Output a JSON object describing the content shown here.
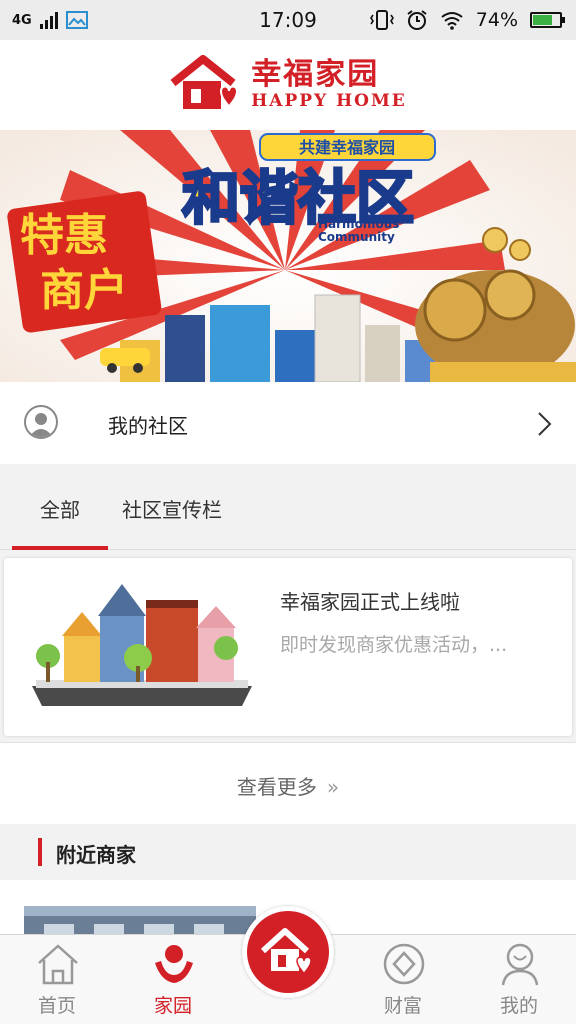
{
  "status_bar": {
    "network": "4G",
    "time": "17:09",
    "battery": "74%",
    "battery_level": 0.74
  },
  "header": {
    "logo_cn": "幸福家园",
    "logo_en": "HAPPY HOME"
  },
  "banner": {
    "ribbon_text": "共建幸福家园",
    "main_title": "和谐社区",
    "subtitle_line1": "Harmonious",
    "subtitle_line2": "Community",
    "left_title_line1": "特惠",
    "left_title_line2": "商户"
  },
  "community": {
    "title": "我的社区"
  },
  "tabs": [
    {
      "label": "全部",
      "active": true
    },
    {
      "label": "社区宣传栏",
      "active": false
    }
  ],
  "news": [
    {
      "title": "幸福家园正式上线啦",
      "summary": "即时发现商家优惠活动，..."
    }
  ],
  "more": {
    "label": "查看更多",
    "chevron": "»"
  },
  "nearby": {
    "title": "附近商家"
  },
  "tabbar": [
    {
      "label": "首页",
      "icon": "home-icon",
      "active": false
    },
    {
      "label": "家园",
      "icon": "family-icon",
      "active": true
    },
    {
      "label": "财富",
      "icon": "wealth-icon",
      "active": false
    },
    {
      "label": "我的",
      "icon": "profile-icon",
      "active": false
    }
  ],
  "colors": {
    "brand_red": "#d32027",
    "text_gray": "#a8a8a8",
    "background": "#f2f2f2"
  }
}
